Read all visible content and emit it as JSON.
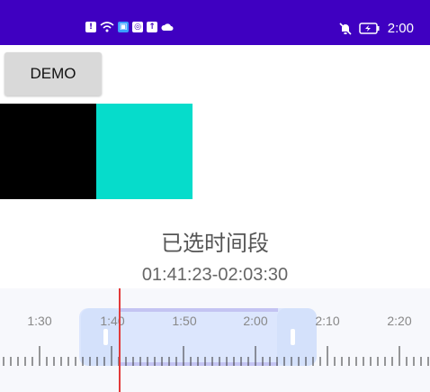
{
  "status_bar": {
    "time": "2:00",
    "left_icons": [
      "alert-icon",
      "wifi-icon",
      "sim-icon",
      "app-icon",
      "upload-icon",
      "cloud-icon"
    ],
    "right_icons": [
      "mute-icon",
      "battery-charging-icon"
    ],
    "background": "#3f00c1"
  },
  "demo_button": {
    "label": "DEMO"
  },
  "swatches": {
    "colors": [
      "#000000",
      "#06dccb"
    ]
  },
  "selection": {
    "title": "已选时间段",
    "range": "01:41:23-02:03:30"
  },
  "timeline": {
    "tick_labels": [
      "1:30",
      "1:40",
      "1:50",
      "2:00",
      "2:10",
      "2:20"
    ],
    "cursor_time": "01:41:23",
    "selected_start": "01:41:23",
    "selected_end": "02:03:30",
    "cursor_color": "#e23a3a",
    "selection_color": "#dce6fd"
  }
}
